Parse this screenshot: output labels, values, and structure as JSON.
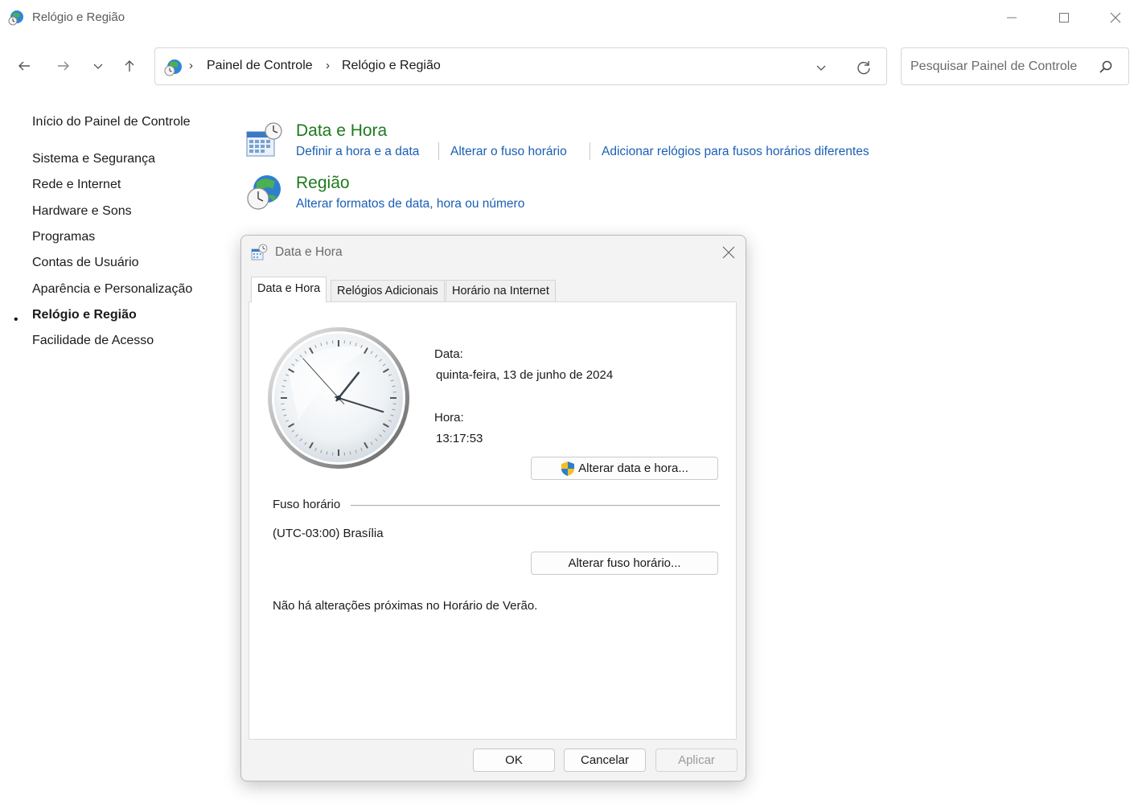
{
  "window": {
    "title": "Relógio e Região"
  },
  "address": {
    "crumbs": [
      "Painel de Controle",
      "Relógio e Região"
    ]
  },
  "search": {
    "placeholder": "Pesquisar Painel de Controle"
  },
  "sidebar": {
    "home": "Início do Painel de Controle",
    "items": [
      {
        "label": "Sistema e Segurança",
        "active": false
      },
      {
        "label": "Rede e Internet",
        "active": false
      },
      {
        "label": "Hardware e Sons",
        "active": false
      },
      {
        "label": "Programas",
        "active": false
      },
      {
        "label": "Contas de Usuário",
        "active": false
      },
      {
        "label": "Aparência e Personalização",
        "active": false
      },
      {
        "label": "Relógio e Região",
        "active": true
      },
      {
        "label": "Facilidade de Acesso",
        "active": false
      }
    ]
  },
  "categories": [
    {
      "title": "Data e Hora",
      "icon": "calendar-clock-icon",
      "links": [
        "Definir a hora e a data",
        "Alterar o fuso horário",
        "Adicionar relógios para fusos horários diferentes"
      ]
    },
    {
      "title": "Região",
      "icon": "globe-clock-icon",
      "links": [
        "Alterar formatos de data, hora ou número"
      ]
    }
  ],
  "dialog": {
    "title": "Data e Hora",
    "tabs": [
      "Data e Hora",
      "Relógios Adicionais",
      "Horário na Internet"
    ],
    "active_tab": 0,
    "date_label": "Data:",
    "date_value": "quinta-feira, 13 de junho de 2024",
    "time_label": "Hora:",
    "time_value": "13:17:53",
    "change_datetime_button": "Alterar data e hora...",
    "timezone_group": "Fuso horário",
    "timezone_value": "(UTC-03:00) Brasília",
    "change_timezone_button": "Alterar fuso horário...",
    "dst_message": "Não há alterações próximas no Horário de Verão.",
    "ok_button": "OK",
    "cancel_button": "Cancelar",
    "apply_button": "Aplicar",
    "clock": {
      "hours": 13,
      "minutes": 17,
      "seconds": 53
    }
  },
  "colors": {
    "link": "#1a5fb4",
    "category_title": "#1e7a1e"
  }
}
